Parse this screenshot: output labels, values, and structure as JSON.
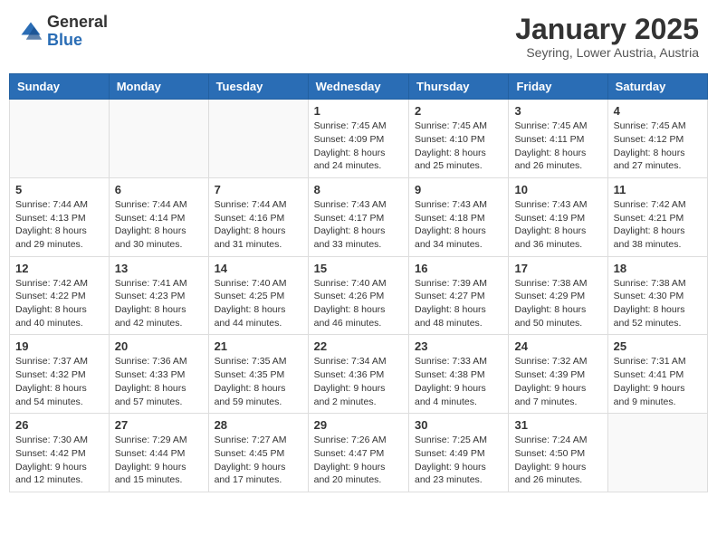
{
  "header": {
    "logo_general": "General",
    "logo_blue": "Blue",
    "month_title": "January 2025",
    "location": "Seyring, Lower Austria, Austria"
  },
  "days_of_week": [
    "Sunday",
    "Monday",
    "Tuesday",
    "Wednesday",
    "Thursday",
    "Friday",
    "Saturday"
  ],
  "weeks": [
    [
      {
        "day": "",
        "info": ""
      },
      {
        "day": "",
        "info": ""
      },
      {
        "day": "",
        "info": ""
      },
      {
        "day": "1",
        "info": "Sunrise: 7:45 AM\nSunset: 4:09 PM\nDaylight: 8 hours and 24 minutes."
      },
      {
        "day": "2",
        "info": "Sunrise: 7:45 AM\nSunset: 4:10 PM\nDaylight: 8 hours and 25 minutes."
      },
      {
        "day": "3",
        "info": "Sunrise: 7:45 AM\nSunset: 4:11 PM\nDaylight: 8 hours and 26 minutes."
      },
      {
        "day": "4",
        "info": "Sunrise: 7:45 AM\nSunset: 4:12 PM\nDaylight: 8 hours and 27 minutes."
      }
    ],
    [
      {
        "day": "5",
        "info": "Sunrise: 7:44 AM\nSunset: 4:13 PM\nDaylight: 8 hours and 29 minutes."
      },
      {
        "day": "6",
        "info": "Sunrise: 7:44 AM\nSunset: 4:14 PM\nDaylight: 8 hours and 30 minutes."
      },
      {
        "day": "7",
        "info": "Sunrise: 7:44 AM\nSunset: 4:16 PM\nDaylight: 8 hours and 31 minutes."
      },
      {
        "day": "8",
        "info": "Sunrise: 7:43 AM\nSunset: 4:17 PM\nDaylight: 8 hours and 33 minutes."
      },
      {
        "day": "9",
        "info": "Sunrise: 7:43 AM\nSunset: 4:18 PM\nDaylight: 8 hours and 34 minutes."
      },
      {
        "day": "10",
        "info": "Sunrise: 7:43 AM\nSunset: 4:19 PM\nDaylight: 8 hours and 36 minutes."
      },
      {
        "day": "11",
        "info": "Sunrise: 7:42 AM\nSunset: 4:21 PM\nDaylight: 8 hours and 38 minutes."
      }
    ],
    [
      {
        "day": "12",
        "info": "Sunrise: 7:42 AM\nSunset: 4:22 PM\nDaylight: 8 hours and 40 minutes."
      },
      {
        "day": "13",
        "info": "Sunrise: 7:41 AM\nSunset: 4:23 PM\nDaylight: 8 hours and 42 minutes."
      },
      {
        "day": "14",
        "info": "Sunrise: 7:40 AM\nSunset: 4:25 PM\nDaylight: 8 hours and 44 minutes."
      },
      {
        "day": "15",
        "info": "Sunrise: 7:40 AM\nSunset: 4:26 PM\nDaylight: 8 hours and 46 minutes."
      },
      {
        "day": "16",
        "info": "Sunrise: 7:39 AM\nSunset: 4:27 PM\nDaylight: 8 hours and 48 minutes."
      },
      {
        "day": "17",
        "info": "Sunrise: 7:38 AM\nSunset: 4:29 PM\nDaylight: 8 hours and 50 minutes."
      },
      {
        "day": "18",
        "info": "Sunrise: 7:38 AM\nSunset: 4:30 PM\nDaylight: 8 hours and 52 minutes."
      }
    ],
    [
      {
        "day": "19",
        "info": "Sunrise: 7:37 AM\nSunset: 4:32 PM\nDaylight: 8 hours and 54 minutes."
      },
      {
        "day": "20",
        "info": "Sunrise: 7:36 AM\nSunset: 4:33 PM\nDaylight: 8 hours and 57 minutes."
      },
      {
        "day": "21",
        "info": "Sunrise: 7:35 AM\nSunset: 4:35 PM\nDaylight: 8 hours and 59 minutes."
      },
      {
        "day": "22",
        "info": "Sunrise: 7:34 AM\nSunset: 4:36 PM\nDaylight: 9 hours and 2 minutes."
      },
      {
        "day": "23",
        "info": "Sunrise: 7:33 AM\nSunset: 4:38 PM\nDaylight: 9 hours and 4 minutes."
      },
      {
        "day": "24",
        "info": "Sunrise: 7:32 AM\nSunset: 4:39 PM\nDaylight: 9 hours and 7 minutes."
      },
      {
        "day": "25",
        "info": "Sunrise: 7:31 AM\nSunset: 4:41 PM\nDaylight: 9 hours and 9 minutes."
      }
    ],
    [
      {
        "day": "26",
        "info": "Sunrise: 7:30 AM\nSunset: 4:42 PM\nDaylight: 9 hours and 12 minutes."
      },
      {
        "day": "27",
        "info": "Sunrise: 7:29 AM\nSunset: 4:44 PM\nDaylight: 9 hours and 15 minutes."
      },
      {
        "day": "28",
        "info": "Sunrise: 7:27 AM\nSunset: 4:45 PM\nDaylight: 9 hours and 17 minutes."
      },
      {
        "day": "29",
        "info": "Sunrise: 7:26 AM\nSunset: 4:47 PM\nDaylight: 9 hours and 20 minutes."
      },
      {
        "day": "30",
        "info": "Sunrise: 7:25 AM\nSunset: 4:49 PM\nDaylight: 9 hours and 23 minutes."
      },
      {
        "day": "31",
        "info": "Sunrise: 7:24 AM\nSunset: 4:50 PM\nDaylight: 9 hours and 26 minutes."
      },
      {
        "day": "",
        "info": ""
      }
    ]
  ]
}
